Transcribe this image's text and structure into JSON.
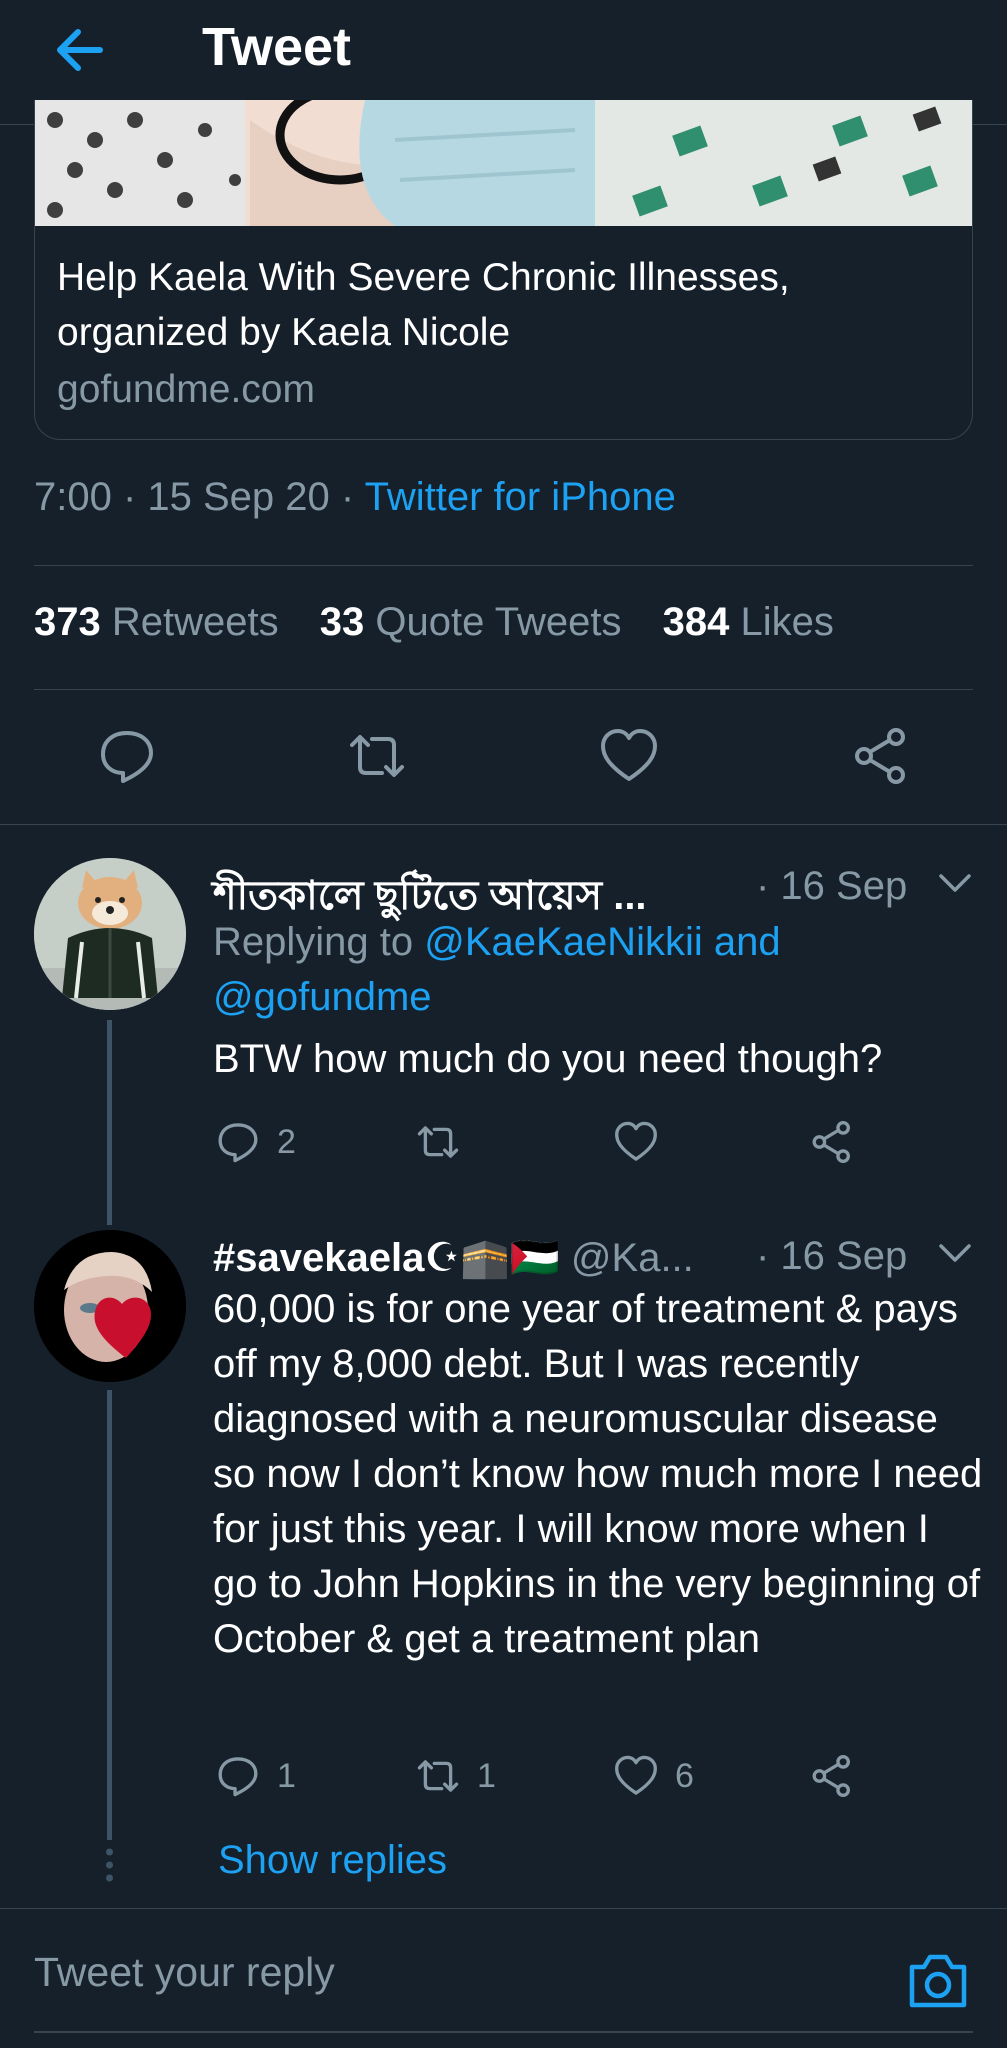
{
  "header": {
    "title": "Tweet"
  },
  "card": {
    "title": "Help Kaela With Severe Chronic Illnesses, organized by Kaela Nicole",
    "domain": "gofundme.com"
  },
  "meta": {
    "time_date": "7:00 · 15 Sep 20 · ",
    "source": "Twitter for iPhone"
  },
  "stats": {
    "retweets_count": "373",
    "retweets_label": "Retweets",
    "quotes_count": "33",
    "quotes_label": "Quote Tweets",
    "likes_count": "384",
    "likes_label": "Likes"
  },
  "replies": [
    {
      "name": "শীতকালে ছুটিতে আয়েস ...",
      "date": "· 16 Sep",
      "replying_prefix": "Replying to ",
      "replying_handles_1": "@KaeKaeNikkii and",
      "replying_handles_2": "@gofundme",
      "text": "BTW how much do you need though?",
      "reply_count": "2"
    },
    {
      "name": "#savekaela",
      "emojis": "☪🕋🇵🇸",
      "handle": " @Ka...",
      "date": "· 16 Sep",
      "text": "60,000 is for one year of treatment & pays off my 8,000 debt. But I was recently diagnosed with a neuromuscular disease so now I don’t know how much more I need for just this year. I will know more when I go to John Hopkins in the very beginning of October & get a treatment plan",
      "reply_count": "1",
      "retweet_count": "1",
      "like_count": "6"
    }
  ],
  "show_replies": "Show replies",
  "compose": {
    "placeholder": "Tweet your reply"
  },
  "colors": {
    "background": "#15202b",
    "accent": "#1da1f2",
    "muted": "#8899a6",
    "divider": "#38444d"
  }
}
